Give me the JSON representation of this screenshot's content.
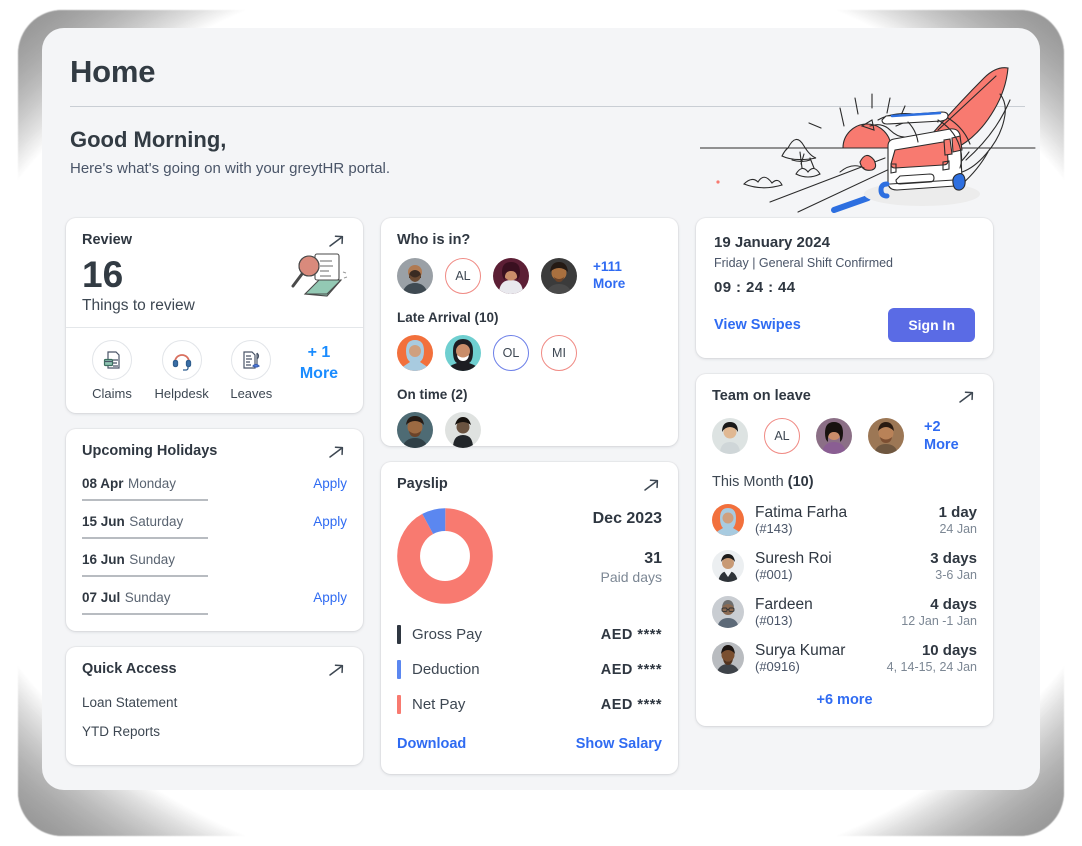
{
  "header": {
    "page_title": "Home",
    "greeting": "Good Morning,",
    "subgreeting": "Here's what's going on with your greytHR portal.",
    "illustration": "campervan-sunrise-illustration"
  },
  "colors": {
    "accent_blue": "#2f6bf2",
    "link_blue": "#1a8cff",
    "signin_button": "#5a6be5",
    "coral": "#f87a70",
    "deduction_blue": "#5b87f0",
    "gross_dark": "#2f3741",
    "page_bg": "#f4f5f7",
    "card_bg": "#ffffff"
  },
  "review_card": {
    "title": "Review",
    "count": "16",
    "subtitle": "Things to review",
    "arrow_icon": "arrow-up-right-icon",
    "illustration": "magnifier-envelope-illustration",
    "actions": [
      {
        "label": "Claims",
        "icon": "claims-document-icon"
      },
      {
        "label": "Helpdesk",
        "icon": "headset-icon"
      },
      {
        "label": "Leaves",
        "icon": "leaves-document-icon"
      }
    ],
    "more_line1": "+ 1",
    "more_line2": "More"
  },
  "holidays_card": {
    "title": "Upcoming Holidays",
    "arrow_icon": "arrow-up-right-icon",
    "rows": [
      {
        "date": "08 Apr",
        "day": "Monday",
        "action": "Apply"
      },
      {
        "date": "15 Jun",
        "day": "Saturday",
        "action": "Apply"
      },
      {
        "date": "16 Jun",
        "day": "Sunday",
        "action": ""
      },
      {
        "date": "07 Jul",
        "day": "Sunday",
        "action": "Apply"
      }
    ]
  },
  "quick_access_card": {
    "title": "Quick Access",
    "arrow_icon": "arrow-up-right-icon",
    "items": [
      "Loan Statement",
      "YTD Reports"
    ]
  },
  "who_is_in_card": {
    "title": "Who is in?",
    "present": [
      {
        "type": "photo",
        "tone": "#9aa0a6",
        "skin": "#b07a52"
      },
      {
        "type": "initials",
        "initials": "AL",
        "ring": "#f08a84"
      },
      {
        "type": "photo",
        "tone": "#5c1f35",
        "skin": "#c98d6a"
      },
      {
        "type": "photo",
        "tone": "#3b3b3b",
        "skin": "#a9703f"
      }
    ],
    "present_more_line1": "+111",
    "present_more_line2": "More",
    "late_label": "Late Arrival (10)",
    "late": [
      {
        "type": "photo",
        "tone": "#f2703c",
        "skin": "#cfa07f"
      },
      {
        "type": "photo",
        "tone": "#6fcfd0",
        "skin": "#c98d6a"
      },
      {
        "type": "initials",
        "initials": "OL",
        "ring": "#6c7fe8"
      },
      {
        "type": "initials",
        "initials": "MI",
        "ring": "#f08a84"
      }
    ],
    "ontime_label": "On time (2)",
    "ontime": [
      {
        "type": "photo",
        "tone": "#4e6b74",
        "skin": "#9c6a42"
      },
      {
        "type": "photo",
        "tone": "#dfe2e0",
        "skin": "#6a5340"
      }
    ]
  },
  "payslip_card": {
    "title": "Payslip",
    "arrow_icon": "arrow-up-right-icon",
    "month": "Dec 2023",
    "paid_days": "31",
    "paid_days_label": "Paid days",
    "lines": [
      {
        "label": "Gross Pay",
        "value": "AED ****",
        "color": "#2f3741"
      },
      {
        "label": "Deduction",
        "value": "AED ****",
        "color": "#5b87f0"
      },
      {
        "label": "Net Pay",
        "value": "AED ****",
        "color": "#f87a70"
      }
    ],
    "download_label": "Download",
    "show_salary_label": "Show Salary",
    "chart_data": {
      "type": "pie",
      "title": "Payslip breakdown",
      "categories": [
        "Net Pay",
        "Deduction"
      ],
      "values": [
        92,
        8
      ],
      "colors": [
        "#f87a70",
        "#5b87f0"
      ],
      "donut": true,
      "inner_radius_pct": 58,
      "legend": "none"
    }
  },
  "attendance_card": {
    "date": "19 January 2024",
    "shift": "Friday | General Shift Confirmed",
    "clock": "09 : 24 : 44",
    "view_swipes_label": "View Swipes",
    "signin_label": "Sign In"
  },
  "team_leave_card": {
    "title": "Team on leave",
    "arrow_icon": "arrow-up-right-icon",
    "avatars": [
      {
        "type": "photo",
        "tone": "#dde3e2",
        "skin": "#2b2b2b"
      },
      {
        "type": "initials",
        "initials": "AL",
        "ring": "#f08a84"
      },
      {
        "type": "photo",
        "tone": "#8b6f86",
        "skin": "#c98d6a"
      },
      {
        "type": "photo",
        "tone": "#9c7755",
        "skin": "#b98258"
      }
    ],
    "avatars_more": "+2 More",
    "month_label": "This Month ",
    "month_count": "(10)",
    "rows": [
      {
        "name": "Fatima Farha",
        "id": "(#143)",
        "days": "1 day",
        "dates": "24 Jan",
        "tone": "#f2703c",
        "skin": "#cfa07f"
      },
      {
        "name": "Suresh Roi",
        "id": "(#001)",
        "days": "3 days",
        "dates": "3-6 Jan",
        "tone": "#eceff1",
        "skin": "#4a4a4a"
      },
      {
        "name": "Fardeen",
        "id": "(#013)",
        "days": "4 days",
        "dates": "12 Jan -1 Jan",
        "tone": "#c9cdd2",
        "skin": "#8a6a52"
      },
      {
        "name": "Surya Kumar",
        "id": "(#0916)",
        "days": "10 days",
        "dates": "4, 14-15, 24 Jan",
        "tone": "#b9bcc0",
        "skin": "#7a4f30"
      }
    ],
    "more_label": "+6 more"
  }
}
